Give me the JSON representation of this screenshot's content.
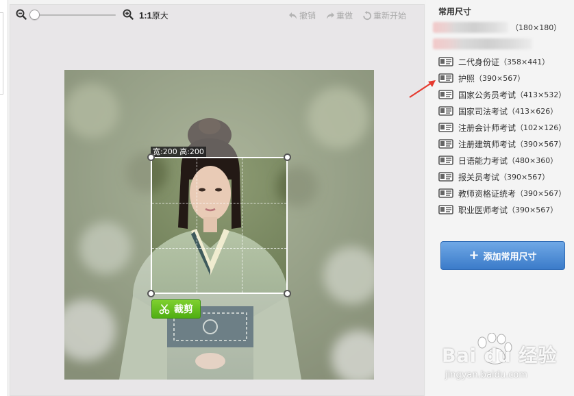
{
  "toolbar": {
    "ratio_bold": "1:1",
    "ratio_text": "原大",
    "undo_label": "撤销",
    "redo_label": "重做",
    "restart_label": "重新开始"
  },
  "crop": {
    "size_label": "宽:200 高:200",
    "crop_button_label": "裁剪"
  },
  "panel": {
    "title": "常用尺寸",
    "blurred_entry_size": "（180×180）",
    "items": [
      {
        "label": "二代身份证",
        "dims": "（358×441）"
      },
      {
        "label": "护照",
        "dims": "（390×567）"
      },
      {
        "label": "国家公务员考试",
        "dims": "（413×532）"
      },
      {
        "label": "国家司法考试",
        "dims": "（413×626）"
      },
      {
        "label": "注册会计师考试",
        "dims": "（102×126）"
      },
      {
        "label": "注册建筑师考试",
        "dims": "（390×567）"
      },
      {
        "label": "日语能力考试",
        "dims": "（480×360）"
      },
      {
        "label": "报关员考试",
        "dims": "（390×567）"
      },
      {
        "label": "教师资格证统考",
        "dims": "（390×567）"
      },
      {
        "label": "职业医师考试",
        "dims": "（390×567）"
      }
    ],
    "add_button_label": "添加常用尺寸"
  },
  "watermark": {
    "brand": "Bai du 经验",
    "url": "jingyan.baidu.com"
  },
  "colors": {
    "crop_green": "#5cb81b",
    "add_blue": "#4a8ad6",
    "annotation_red": "#e53a2f"
  }
}
